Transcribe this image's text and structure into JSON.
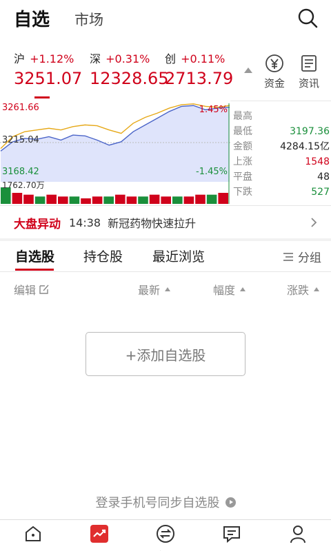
{
  "header": {
    "active_tab": "自选",
    "tab_market": "市场",
    "search_icon": "search-icon"
  },
  "indices": [
    {
      "name": "沪",
      "change": "+1.12%",
      "value": "3251.07"
    },
    {
      "name": "深",
      "change": "+0.31%",
      "value": "12328.65"
    },
    {
      "name": "创",
      "change": "+0.11%",
      "value": "2713.79"
    }
  ],
  "quick_actions": [
    {
      "label": "资金",
      "icon": "yuan-circle-icon"
    },
    {
      "label": "资讯",
      "icon": "document-icon"
    }
  ],
  "chart": {
    "high_price": "3261.66",
    "mid_price": "3215.04",
    "low_price": "3168.42",
    "high_pct": "1.45%",
    "low_pct": "-1.45%",
    "volume_max": "1762.70万"
  },
  "chart_data": {
    "type": "line",
    "ylim": [
      3168.42,
      3261.66
    ],
    "reference": 3215.04,
    "series": [
      {
        "color": "#e6a817",
        "values": [
          3208,
          3222,
          3228,
          3230,
          3232,
          3230,
          3234,
          3236,
          3235,
          3230,
          3226,
          3238,
          3245,
          3250,
          3256,
          3260,
          3261,
          3258,
          3257,
          3259
        ]
      },
      {
        "color": "#4a64c8",
        "values": [
          3205,
          3216,
          3220,
          3219,
          3222,
          3218,
          3224,
          3223,
          3218,
          3212,
          3216,
          3228,
          3236,
          3244,
          3252,
          3258,
          3259,
          3254,
          3256,
          3257
        ]
      }
    ],
    "volume": [
      9,
      6,
      5,
      4,
      5,
      4,
      4,
      3,
      4,
      4,
      5,
      4,
      4,
      5,
      4,
      4,
      4,
      5,
      5,
      6
    ]
  },
  "stats": [
    {
      "key": "最高",
      "value": "",
      "color": "#d0021b"
    },
    {
      "key": "最低",
      "value": "3197.36",
      "color": "#1a8f3b"
    },
    {
      "key": "金额",
      "value": "4284.15亿",
      "color": "#222222"
    },
    {
      "key": "上涨",
      "value": "1548",
      "color": "#d0021b"
    },
    {
      "key": "平盘",
      "value": "48",
      "color": "#222222"
    },
    {
      "key": "下跌",
      "value": "527",
      "color": "#1a8f3b"
    }
  ],
  "alert": {
    "title": "大盘异动",
    "time": "14:38",
    "text": "新冠药物快速拉升"
  },
  "list_tabs": [
    "自选股",
    "持仓股",
    "最近浏览"
  ],
  "group_label": "分组",
  "columns": {
    "edit": "编辑",
    "latest": "最新",
    "range": "幅度",
    "change": "涨跌"
  },
  "add_button": "+添加自选股",
  "login_hint": "登录手机号同步自选股",
  "nav": [
    {
      "label": "首页",
      "icon": "home-icon"
    },
    {
      "label": "行情",
      "icon": "trend-icon"
    },
    {
      "label": "交易",
      "icon": "trade-icon"
    },
    {
      "label": "资讯",
      "icon": "news-icon"
    },
    {
      "label": "我的",
      "icon": "user-icon"
    }
  ],
  "colors": {
    "accent": "#d0021b",
    "up": "#d0021b",
    "down": "#1a8f3b"
  }
}
